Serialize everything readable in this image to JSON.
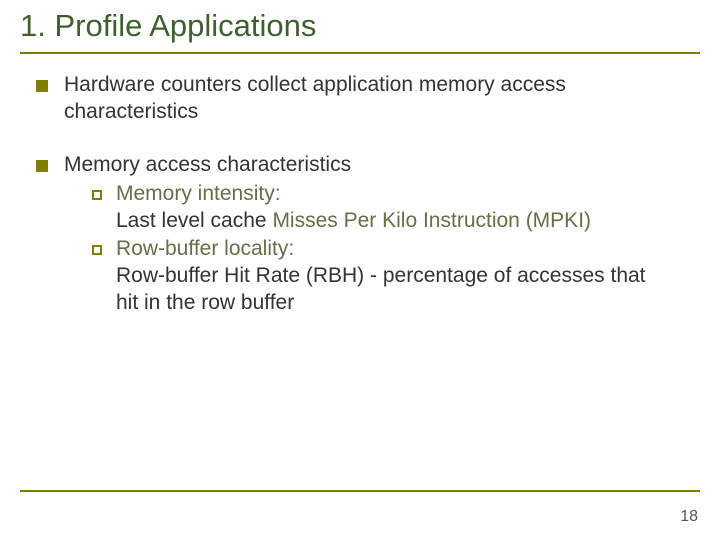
{
  "title": "1. Profile Applications",
  "bullets": [
    {
      "text": "Hardware counters collect application memory access characteristics"
    },
    {
      "text": "Memory access characteristics",
      "children": [
        {
          "label": "Memory intensity:",
          "line1_a": "Last level cache ",
          "line1_b": "Misses Per Kilo Instruction (MPKI)"
        },
        {
          "label": "Row-buffer locality:",
          "line1_a": "Row-buffer Hit Rate (RBH)",
          "line1_b": " - percentage of accesses that hit in the row buffer"
        }
      ]
    }
  ],
  "page_number": "18"
}
